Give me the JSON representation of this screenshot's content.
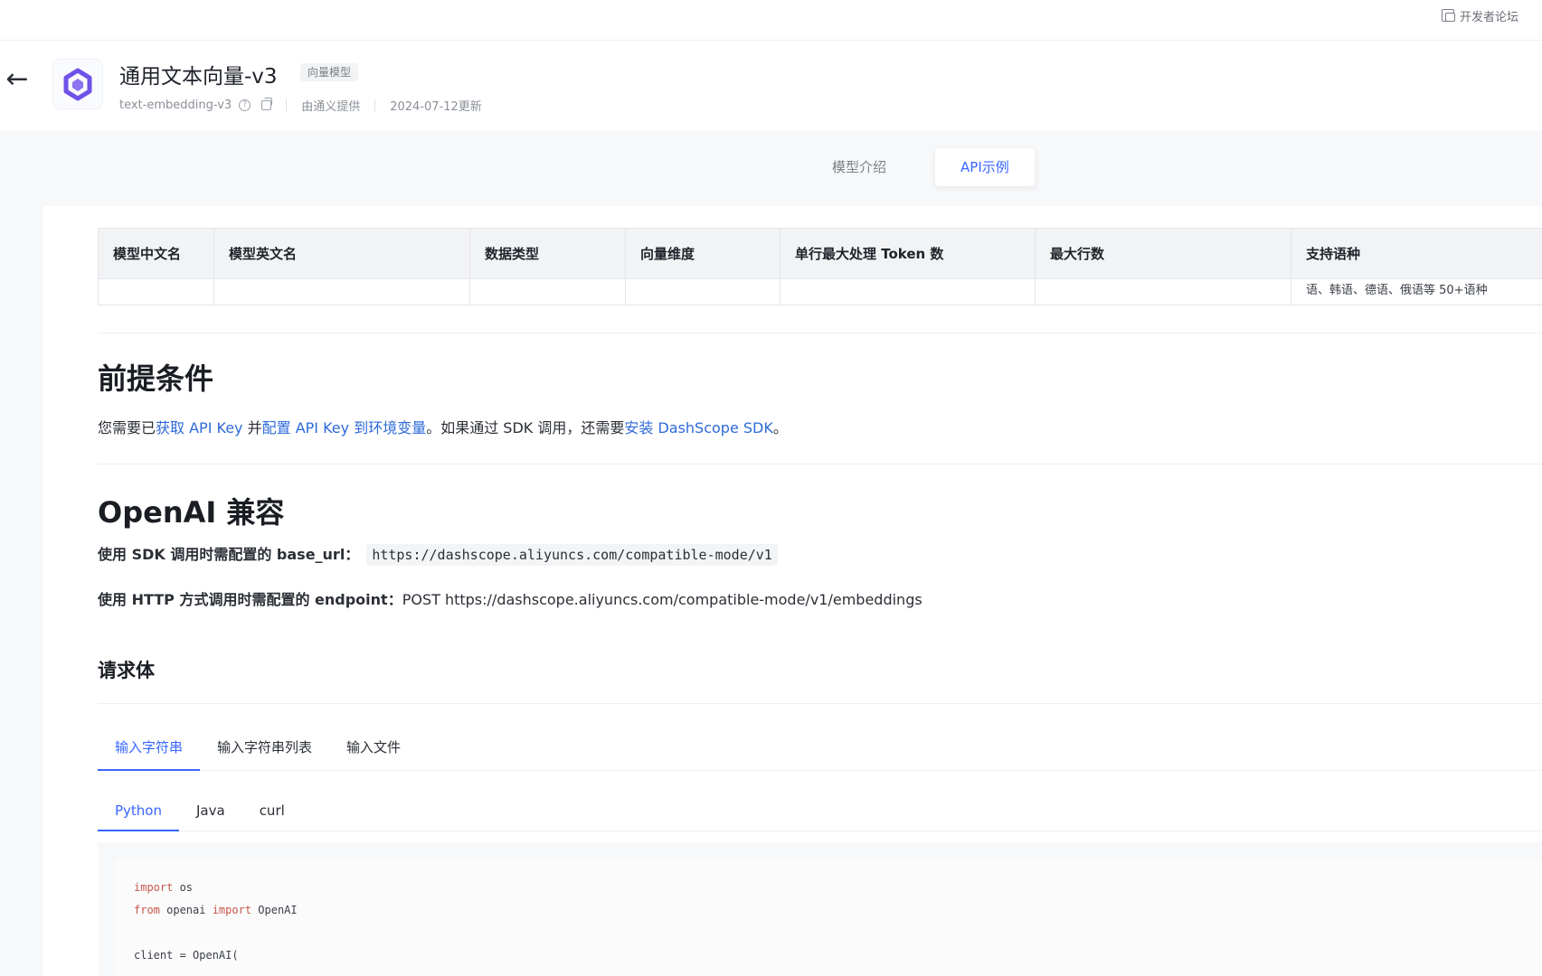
{
  "topbar": {
    "forum_label": "开发者论坛"
  },
  "header": {
    "back_icon": "arrow-left-icon",
    "title": "通用文本向量-v3",
    "type_tag": "向量模型",
    "model_code": "text-embedding-v3",
    "provider": "由通义提供",
    "updated": "2024-07-12更新"
  },
  "page_tabs": [
    {
      "label": "模型介绍",
      "active": false
    },
    {
      "label": "API示例",
      "active": true
    }
  ],
  "table": {
    "headers": [
      "模型中文名",
      "模型英文名",
      "数据类型",
      "向量维度",
      "单行最大处理 Token 数",
      "最大行数",
      "支持语种"
    ],
    "row": [
      "",
      "",
      "",
      "",
      "",
      "",
      "语、韩语、德语、俄语等 50+语种"
    ]
  },
  "prereq": {
    "heading": "前提条件",
    "t1": "您需要已",
    "l1": "获取 API Key",
    "t2": " 并",
    "l2": "配置 API Key 到环境变量",
    "t3": "。如果通过 SDK 调用，还需要",
    "l3": "安装 DashScope SDK",
    "t4": "。"
  },
  "openai": {
    "heading": "OpenAI 兼容",
    "base_label": "使用 SDK 调用时需配置的 base_url：",
    "base_url": "https://dashscope.aliyuncs.com/compatible-mode/v1",
    "endpoint_label": "使用 HTTP 方式调用时需配置的 endpoint：",
    "endpoint": "POST https://dashscope.aliyuncs.com/compatible-mode/v1/embeddings"
  },
  "request": {
    "heading": "请求体",
    "input_tabs": [
      "输入字符串",
      "输入字符串列表",
      "输入文件"
    ],
    "lang_tabs": [
      "Python",
      "Java",
      "curl"
    ]
  },
  "code": {
    "l1_kw": "import",
    "l1_rest": " os",
    "l2_kw1": "from",
    "l2_mid": " openai ",
    "l2_kw2": "import",
    "l2_rest": " OpenAI",
    "l4": "client = OpenAI("
  },
  "colors": {
    "accent": "#3866ff",
    "link": "#2e6ad8",
    "keyword": "#c6574a"
  }
}
